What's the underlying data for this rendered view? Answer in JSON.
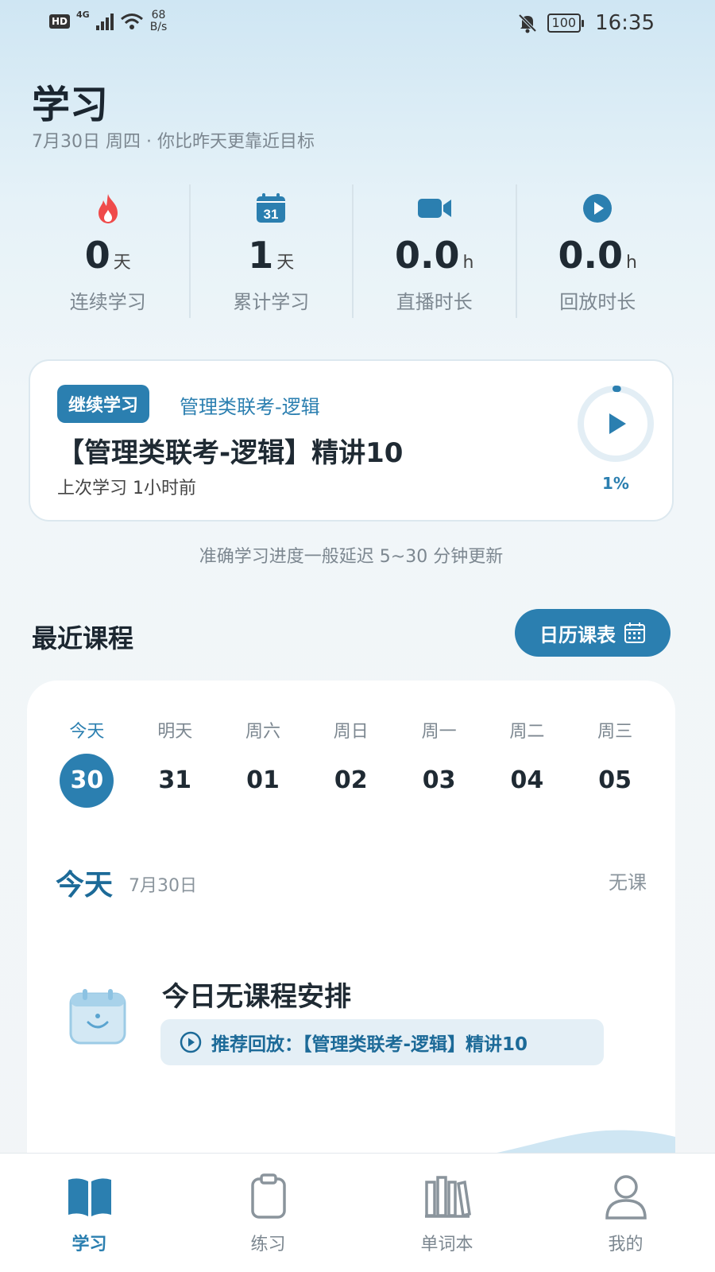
{
  "status_bar": {
    "hd": "HD",
    "network": "4G",
    "speed_value": "68",
    "speed_unit": "B/s",
    "battery": "100",
    "time": "16:35"
  },
  "header": {
    "title": "学习",
    "subtitle": "7月30日 周四 · 你比昨天更靠近目标"
  },
  "stats": [
    {
      "icon": "flame-icon",
      "value": "0",
      "unit": "天",
      "label": "连续学习"
    },
    {
      "icon": "calendar-icon",
      "icon_text": "31",
      "value": "1",
      "unit": "天",
      "label": "累计学习"
    },
    {
      "icon": "video-camera-icon",
      "value": "0.0",
      "unit": "h",
      "label": "直播时长"
    },
    {
      "icon": "play-circle-icon",
      "value": "0.0",
      "unit": "h",
      "label": "回放时长"
    }
  ],
  "continue_card": {
    "badge": "继续学习",
    "course": "管理类联考-逻辑",
    "lesson": "【管理类联考-逻辑】精讲10",
    "last_study": "上次学习 1小时前",
    "progress": 0.01,
    "progress_label": "1%"
  },
  "note": "准确学习进度一般延迟 5~30 分钟更新",
  "recent": {
    "title": "最近课程",
    "calendar_button": "日历课表"
  },
  "days": [
    {
      "name": "今天",
      "num": "30",
      "active": true
    },
    {
      "name": "明天",
      "num": "31"
    },
    {
      "name": "周六",
      "num": "01"
    },
    {
      "name": "周日",
      "num": "02"
    },
    {
      "name": "周一",
      "num": "03"
    },
    {
      "name": "周二",
      "num": "04"
    },
    {
      "name": "周三",
      "num": "05"
    }
  ],
  "today": {
    "title": "今天",
    "date": "7月30日",
    "status": "无课",
    "empty_title": "今日无课程安排",
    "recommend": "推荐回放：【管理类联考-逻辑】精讲10"
  },
  "nav": [
    {
      "label": "学习",
      "icon": "book-icon",
      "active": true
    },
    {
      "label": "练习",
      "icon": "clipboard-icon"
    },
    {
      "label": "单词本",
      "icon": "bookshelf-icon"
    },
    {
      "label": "我的",
      "icon": "user-icon"
    }
  ],
  "colors": {
    "accent": "#2b7fb0",
    "flame": "#ef4b4b",
    "text": "#1f2a33",
    "muted": "#7c8790"
  }
}
